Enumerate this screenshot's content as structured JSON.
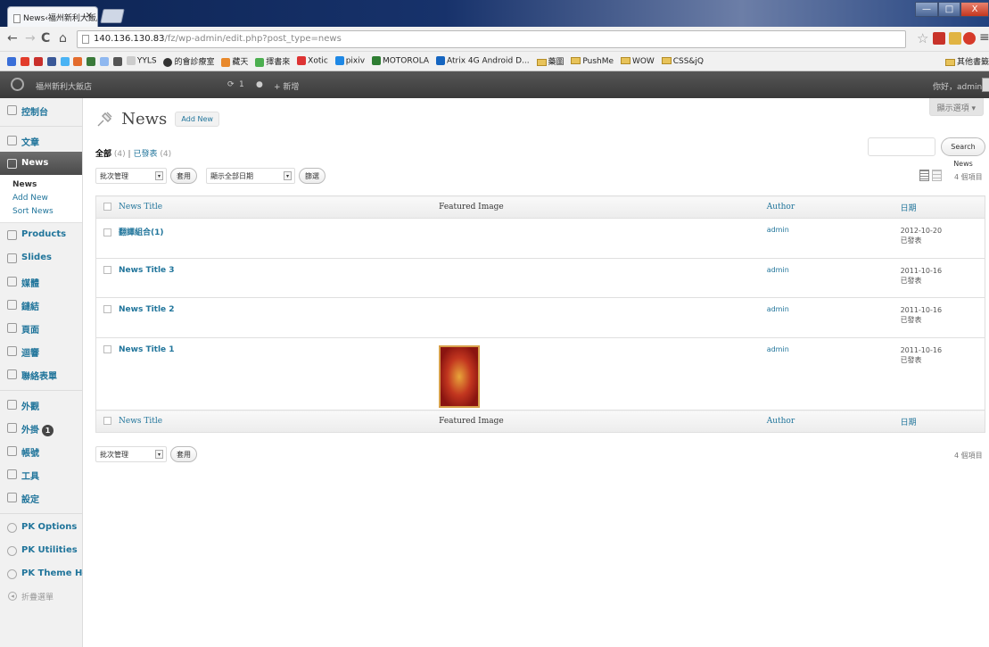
{
  "browser": {
    "tab_title": "News‹福州新利大飯店",
    "tab_close": "×",
    "url_host": "140.136.130.83",
    "url_path": "/fz/wp-admin/edit.php?post_type=news",
    "back": "←",
    "forward": "→",
    "reload": "C",
    "home": "⌂",
    "bookmarks": [
      "YYLS",
      "的會診療室",
      "藏天",
      "擇書來",
      "Xotic",
      "pixiv",
      "MOTOROLA",
      "Atrix 4G Android D...",
      "藥圖",
      "PushMe",
      "WOW",
      "CSS&jQ"
    ],
    "other_bookmarks": "其他書籤",
    "window_min": "—",
    "window_max": "□",
    "window_close": "X"
  },
  "adminbar": {
    "site_name": "福州新利大飯店",
    "comments_count": "1",
    "new_label": "新增",
    "greeting": "你好，admin"
  },
  "sidebar": {
    "dashboard": "控制台",
    "posts": "文章",
    "news": "News",
    "news_sub": [
      "News",
      "Add New",
      "Sort News"
    ],
    "products": "Products",
    "slides": "Slides",
    "media": "媒體",
    "links": "鏈結",
    "pages": "頁面",
    "comments": "迴響",
    "contact_form": "聯絡表單",
    "appearance": "外觀",
    "plugins": "外掛",
    "plugins_badge": "1",
    "users": "帳號",
    "tools": "工具",
    "settings": "設定",
    "pk_options": "PK Options",
    "pk_utilities": "PK Utilities",
    "pk_theme_help": "PK Theme Help",
    "collapse": "折疊選單"
  },
  "main": {
    "screen_options": "顯示選項 ▾",
    "title": "News",
    "add_new": "Add New",
    "filter_all": "全部",
    "filter_all_count": "(4)",
    "filter_sep": "|",
    "filter_published": "已發表",
    "filter_published_count": "(4)",
    "search_button": "Search News",
    "bulk_action": "批次管理",
    "apply": "套用",
    "date_filter": "顯示全部日期",
    "filter_button": "篩選",
    "items_count": "4 個項目",
    "columns": [
      "News Title",
      "Featured Image",
      "Author",
      "日期"
    ],
    "rows": [
      {
        "title": "翻譯組合(1)",
        "author": "admin",
        "date": "2012-10-20",
        "status": "已發表",
        "has_image": false
      },
      {
        "title": "News Title 3",
        "author": "admin",
        "date": "2011-10-16",
        "status": "已發表",
        "has_image": false
      },
      {
        "title": "News Title 2",
        "author": "admin",
        "date": "2011-10-16",
        "status": "已發表",
        "has_image": false
      },
      {
        "title": "News Title 1",
        "author": "admin",
        "date": "2011-10-16",
        "status": "已發表",
        "has_image": true
      }
    ]
  },
  "colors": {
    "link": "#21759b",
    "admin_bar": "#464646",
    "sidebar_bg": "#f1f1f1",
    "current_menu": "#5a5a5a"
  }
}
